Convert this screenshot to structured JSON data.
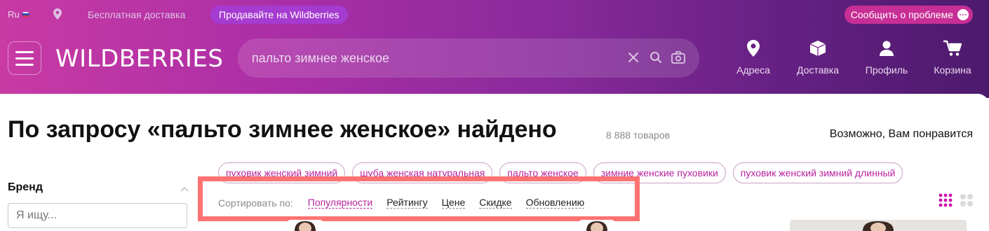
{
  "topbar": {
    "lang": "Ru",
    "free_shipping": "Бесплатная доставка",
    "sell_button": "Продавайте на Wildberries",
    "report_button": "Сообщить о проблеме"
  },
  "header": {
    "logo": "WILDBERRIES",
    "search_value": "пальто зимнее женское",
    "nav": {
      "addresses": "Адреса",
      "delivery": "Доставка",
      "profile": "Профиль",
      "cart": "Корзина"
    }
  },
  "main": {
    "title": "По запросу «пальто зимнее женское» найдено",
    "count": "8 888 товаров",
    "recommend": "Возможно, Вам понравится",
    "tags": [
      "пуховик женский зимний",
      "шуба женская натуральная",
      "пальто женское",
      "зимние женские пуховики",
      "пуховик женский зимний длинный"
    ],
    "sort": {
      "label": "Сортировать по:",
      "options": [
        "Популярности",
        "Рейтингу",
        "Цене",
        "Скидке",
        "Обновлению"
      ],
      "active": "Популярности"
    }
  },
  "filters": {
    "brand_title": "Бренд",
    "brand_placeholder": "Я ищу..."
  },
  "colors": {
    "brand_pink": "#cb11ab",
    "accent_tag": "#b8239f",
    "highlight_box": "#ff7272"
  }
}
